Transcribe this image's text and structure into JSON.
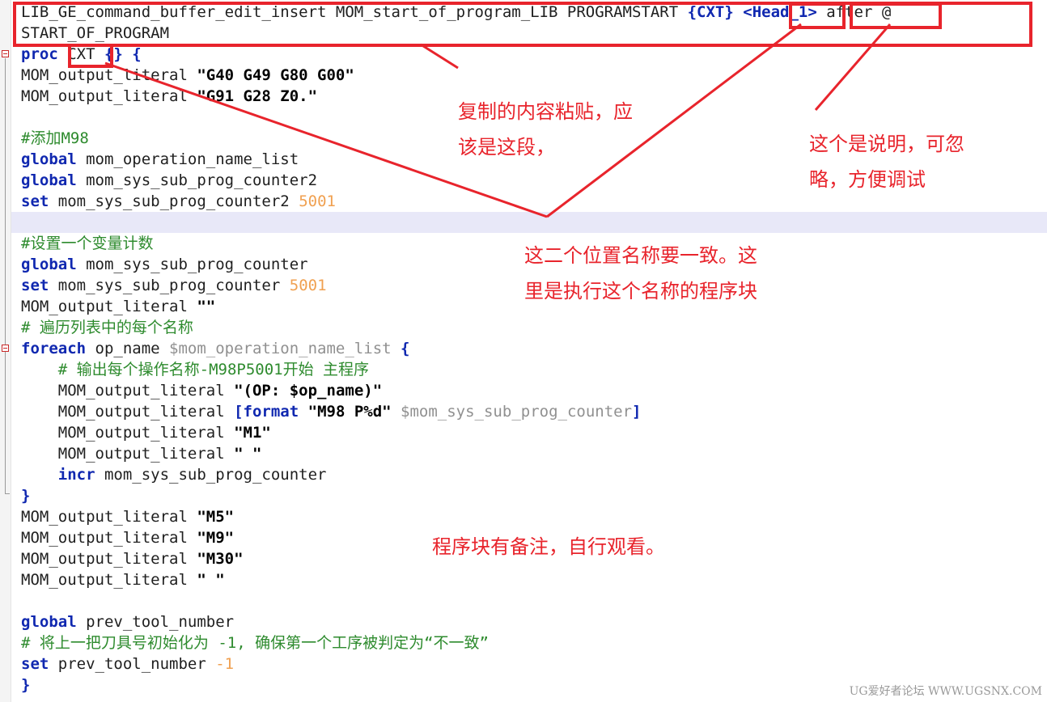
{
  "editor": {
    "lines": [
      {
        "parts": [
          {
            "t": "LIB_GE_command_buffer_edit_insert MOM_start_of_program_LIB PROGRAMSTART ",
            "c": ""
          },
          {
            "t": "{CXT}",
            "c": "br"
          },
          {
            "t": " ",
            "c": ""
          },
          {
            "t": "<Head_1>",
            "c": "br"
          },
          {
            "t": " after @",
            "c": ""
          }
        ]
      },
      {
        "parts": [
          {
            "t": "START_OF_PROGRAM",
            "c": ""
          }
        ]
      },
      {
        "parts": [
          {
            "t": "proc",
            "c": "kw"
          },
          {
            "t": " CXT ",
            "c": ""
          },
          {
            "t": "{} {",
            "c": "br"
          }
        ]
      },
      {
        "parts": [
          {
            "t": "MOM_output_literal ",
            "c": ""
          },
          {
            "t": "\"G40 G49 G80 G00\"",
            "c": "str"
          }
        ]
      },
      {
        "parts": [
          {
            "t": "MOM_output_literal ",
            "c": ""
          },
          {
            "t": "\"G91 G28 Z0.\"",
            "c": "str"
          }
        ]
      },
      {
        "parts": []
      },
      {
        "parts": [
          {
            "t": "#添加M98",
            "c": "cmt"
          }
        ]
      },
      {
        "parts": [
          {
            "t": "global",
            "c": "kw"
          },
          {
            "t": " mom_operation_name_list",
            "c": ""
          }
        ]
      },
      {
        "parts": [
          {
            "t": "global",
            "c": "kw"
          },
          {
            "t": " mom_sys_sub_prog_counter2",
            "c": ""
          }
        ]
      },
      {
        "parts": [
          {
            "t": "set",
            "c": "kw"
          },
          {
            "t": " mom_sys_sub_prog_counter2 ",
            "c": ""
          },
          {
            "t": "5001",
            "c": "num"
          }
        ]
      },
      {
        "parts": []
      },
      {
        "parts": [
          {
            "t": "#设置一个变量计数",
            "c": "cmt"
          }
        ]
      },
      {
        "parts": [
          {
            "t": "global",
            "c": "kw"
          },
          {
            "t": " mom_sys_sub_prog_counter",
            "c": ""
          }
        ]
      },
      {
        "parts": [
          {
            "t": "set",
            "c": "kw"
          },
          {
            "t": " mom_sys_sub_prog_counter ",
            "c": ""
          },
          {
            "t": "5001",
            "c": "num"
          }
        ]
      },
      {
        "parts": [
          {
            "t": "MOM_output_literal ",
            "c": ""
          },
          {
            "t": "\"\"",
            "c": "str"
          }
        ]
      },
      {
        "parts": [
          {
            "t": "# 遍历列表中的每个名称",
            "c": "cmt"
          }
        ]
      },
      {
        "parts": [
          {
            "t": "foreach",
            "c": "kw"
          },
          {
            "t": " op_name ",
            "c": ""
          },
          {
            "t": "$mom_operation_name_list",
            "c": "var"
          },
          {
            "t": " {",
            "c": "br"
          }
        ]
      },
      {
        "parts": [
          {
            "t": "    # 输出每个操作名称-M98P5001开始 主程序",
            "c": "cmt"
          }
        ]
      },
      {
        "parts": [
          {
            "t": "    MOM_output_literal ",
            "c": ""
          },
          {
            "t": "\"(OP: $op_name)\"",
            "c": "str"
          }
        ]
      },
      {
        "parts": [
          {
            "t": "    MOM_output_literal ",
            "c": ""
          },
          {
            "t": "[format",
            "c": "kw"
          },
          {
            "t": " ",
            "c": ""
          },
          {
            "t": "\"M98 P%d\"",
            "c": "str"
          },
          {
            "t": " ",
            "c": ""
          },
          {
            "t": "$mom_sys_sub_prog_counter",
            "c": "var"
          },
          {
            "t": "]",
            "c": "br"
          }
        ]
      },
      {
        "parts": [
          {
            "t": "    MOM_output_literal ",
            "c": ""
          },
          {
            "t": "\"M1\"",
            "c": "str"
          }
        ]
      },
      {
        "parts": [
          {
            "t": "    MOM_output_literal ",
            "c": ""
          },
          {
            "t": "\" \"",
            "c": "str"
          }
        ]
      },
      {
        "parts": [
          {
            "t": "    incr",
            "c": "kw"
          },
          {
            "t": " mom_sys_sub_prog_counter",
            "c": ""
          }
        ]
      },
      {
        "parts": [
          {
            "t": "}",
            "c": "br"
          }
        ]
      },
      {
        "parts": [
          {
            "t": "MOM_output_literal ",
            "c": ""
          },
          {
            "t": "\"M5\"",
            "c": "str"
          }
        ]
      },
      {
        "parts": [
          {
            "t": "MOM_output_literal ",
            "c": ""
          },
          {
            "t": "\"M9\"",
            "c": "str"
          }
        ]
      },
      {
        "parts": [
          {
            "t": "MOM_output_literal ",
            "c": ""
          },
          {
            "t": "\"M30\"",
            "c": "str"
          }
        ]
      },
      {
        "parts": [
          {
            "t": "MOM_output_literal ",
            "c": ""
          },
          {
            "t": "\" \"",
            "c": "str"
          }
        ]
      },
      {
        "parts": []
      },
      {
        "parts": [
          {
            "t": "global",
            "c": "kw"
          },
          {
            "t": " prev_tool_number",
            "c": ""
          }
        ]
      },
      {
        "parts": [
          {
            "t": "# 将上一把刀具号初始化为 -1, 确保第一个工序被判定为“不一致”",
            "c": "cmt"
          }
        ]
      },
      {
        "parts": [
          {
            "t": "set",
            "c": "kw"
          },
          {
            "t": " prev_tool_number ",
            "c": ""
          },
          {
            "t": "-1",
            "c": "num"
          }
        ]
      },
      {
        "parts": [
          {
            "t": "}",
            "c": "br"
          }
        ]
      }
    ]
  },
  "annotations": {
    "note_copy": "复制的内容粘贴，应\n该是这段，",
    "note_desc": "这个是说明，可忽\n略，方便调试",
    "note_name": "这二个位置名称要一致。这\n里是执行这个名称的程序块",
    "note_block": "程序块有备注，自行观看。",
    "annotation_color": "#e8242c"
  },
  "watermark": "UG爱好者论坛 WWW.UGSNX.COM"
}
